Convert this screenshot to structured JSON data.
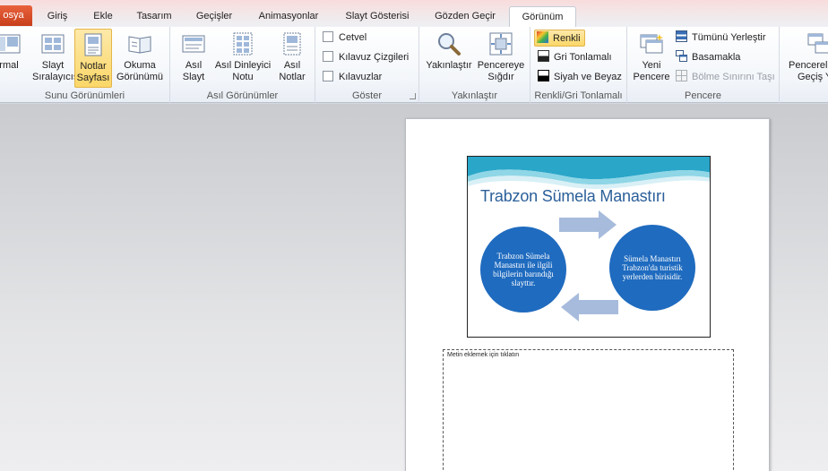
{
  "tabs": {
    "file": "osya",
    "items": [
      "Giriş",
      "Ekle",
      "Tasarım",
      "Geçişler",
      "Animasyonlar",
      "Slayt Gösterisi",
      "Gözden Geçir",
      "Görünüm"
    ],
    "active": "Görünüm"
  },
  "ribbon": {
    "presentation_views": {
      "label": "Sunu Görünümleri",
      "normal": [
        "rmal",
        ""
      ],
      "slide_sorter": [
        "Slayt",
        "Sıralayıcısı"
      ],
      "notes_page": [
        "Notlar",
        "Sayfası"
      ],
      "reading_view": [
        "Okuma",
        "Görünümü"
      ]
    },
    "master_views": {
      "label": "Asıl Görünümler",
      "slide_master": [
        "Asıl",
        "Slayt"
      ],
      "handout_master": [
        "Asıl Dinleyici",
        "Notu"
      ],
      "notes_master": [
        "Asıl",
        "Notlar"
      ]
    },
    "show": {
      "label": "Göster",
      "ruler": "Cetvel",
      "gridlines": "Kılavuz Çizgileri",
      "guides": "Kılavuzlar"
    },
    "zoom": {
      "label": "Yakınlaştır",
      "zoom": [
        "Yakınlaştır",
        ""
      ],
      "fit": [
        "Pencereye",
        "Sığdır"
      ]
    },
    "color": {
      "label": "Renkli/Gri Tonlamalı",
      "color": "Renkli",
      "grayscale": "Gri Tonlamalı",
      "bw": "Siyah ve Beyaz"
    },
    "window": {
      "label": "Pencere",
      "new_window": [
        "Yeni",
        "Pencere"
      ],
      "arrange_all": "Tümünü Yerleştir",
      "cascade": "Basamakla",
      "move_split": "Bölme Sınırını Taşı",
      "switch_windows": [
        "Pencerel",
        "Geçiş Ya"
      ]
    }
  },
  "slide": {
    "title": "Trabzon Sümela Manastırı",
    "left_circle": "Trabzon Sümela Manastırı ile ilgili bilgilerin barındığı slayttır.",
    "right_circle": "Sümela Manastırı Trabzon'da turistik yerlerden birisidir."
  },
  "notes": {
    "placeholder": "Metin eklemek  için tıklatın"
  },
  "colors": {
    "accent_blue": "#1f6bbf",
    "title_blue": "#2b5f9a",
    "arrow": "#a7bbdc",
    "selected_bg": "#fbd768"
  }
}
